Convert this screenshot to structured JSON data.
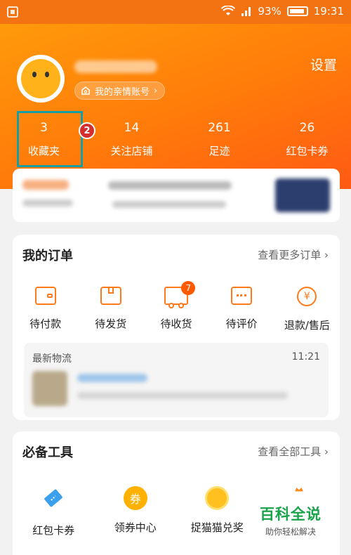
{
  "status_bar": {
    "battery": "93%",
    "time": "19:31"
  },
  "header": {
    "family_account": "我的亲情账号",
    "settings": "设置",
    "stats": [
      {
        "value": "3",
        "label": "收藏夹"
      },
      {
        "value": "14",
        "label": "关注店铺"
      },
      {
        "value": "261",
        "label": "足迹"
      },
      {
        "value": "26",
        "label": "红包卡券"
      }
    ],
    "step_badge": "2"
  },
  "orders": {
    "title": "我的订单",
    "more": "查看更多订单 ›",
    "items": [
      {
        "label": "待付款",
        "icon": "wallet-icon"
      },
      {
        "label": "待发货",
        "icon": "package-icon"
      },
      {
        "label": "待收货",
        "icon": "truck-icon",
        "badge": "7"
      },
      {
        "label": "待评价",
        "icon": "comment-icon"
      },
      {
        "label": "退款/售后",
        "icon": "refund-icon"
      }
    ],
    "logistics": {
      "title": "最新物流",
      "time": "11:21"
    }
  },
  "tools": {
    "title": "必备工具",
    "more": "查看全部工具 ›",
    "items": [
      {
        "label": "红包卡券",
        "icon": "ticket-icon"
      },
      {
        "label": "领券中心",
        "icon": "coupon-icon",
        "glyph": "券"
      },
      {
        "label": "捉猫猫兑奖",
        "icon": "cat-coin-icon"
      }
    ]
  },
  "watermark": {
    "main": "百科全说",
    "sub": "助你轻松解决"
  },
  "colors": {
    "accent": "#ff7a0a",
    "highlight": "#159ea6",
    "badge": "#d32f2f"
  }
}
